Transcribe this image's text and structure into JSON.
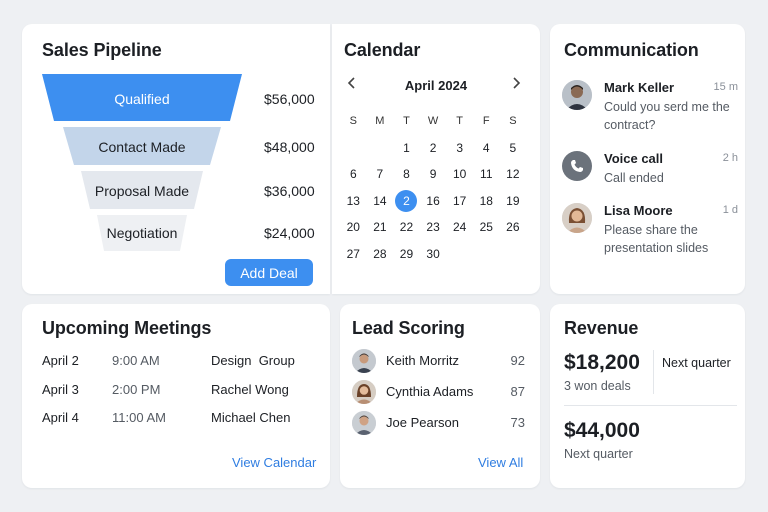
{
  "pipeline": {
    "title": "Sales Pipeline",
    "stages": [
      {
        "label": "Qualified",
        "amount": "$56,000"
      },
      {
        "label": "Contact Made",
        "amount": "$48,000"
      },
      {
        "label": "Proposal Made",
        "amount": "$36,000"
      },
      {
        "label": "Negotiation",
        "amount": "$24,000"
      }
    ],
    "add_label": "Add Deal"
  },
  "calendar": {
    "title": "Calendar",
    "month": "April 2024",
    "weekdays": [
      "S",
      "M",
      "T",
      "W",
      "T",
      "F",
      "S"
    ],
    "weeks": [
      [
        "",
        "",
        "1",
        "2",
        "3",
        "4",
        "5"
      ],
      [
        "6",
        "7",
        "8",
        "9",
        "10",
        "11",
        "12"
      ],
      [
        "13",
        "14",
        "2",
        "16",
        "17",
        "18",
        "19"
      ],
      [
        "20",
        "21",
        "22",
        "23",
        "24",
        "25",
        "26"
      ],
      [
        "27",
        "28",
        "29",
        "30",
        "",
        "",
        ""
      ]
    ],
    "selected": "2"
  },
  "communication": {
    "title": "Communication",
    "items": [
      {
        "name": "Mark Keller",
        "time": "15 m",
        "text": "Could you serd me the contract?"
      },
      {
        "name": "Voice call",
        "time": "2 h",
        "text": "Call ended"
      },
      {
        "name": "Lisa Moore",
        "time": "1 d",
        "text": "Please share the presentation slides"
      }
    ]
  },
  "meetings": {
    "title": "Upcoming Meetings",
    "rows": [
      {
        "date": "April 2",
        "time": "9:00 AM",
        "name": "Design  Group"
      },
      {
        "date": "April 3",
        "time": "2:00 PM",
        "name": "Rachel Wong"
      },
      {
        "date": "April 4",
        "time": "11:00 AM",
        "name": "Michael Chen"
      }
    ],
    "link": "View Calendar"
  },
  "lead": {
    "title": "Lead Scoring",
    "rows": [
      {
        "name": "Keith Morritz",
        "score": "92"
      },
      {
        "name": "Cynthia Adams",
        "score": "87"
      },
      {
        "name": "Joe Pearson",
        "score": "73"
      }
    ],
    "link": "View All"
  },
  "revenue": {
    "title": "Revenue",
    "amount1": "$18,200",
    "sub1": "3 won deals",
    "side": "Next quarter",
    "amount2": "$44,000",
    "sub2": "Next quarter"
  },
  "colors": {
    "accent": "#3d8ff0",
    "funnel_1": "#3d8ff0",
    "funnel_2": "#c3d5ea",
    "funnel_3": "#e4e8ee",
    "funnel_4": "#eef0f3"
  }
}
